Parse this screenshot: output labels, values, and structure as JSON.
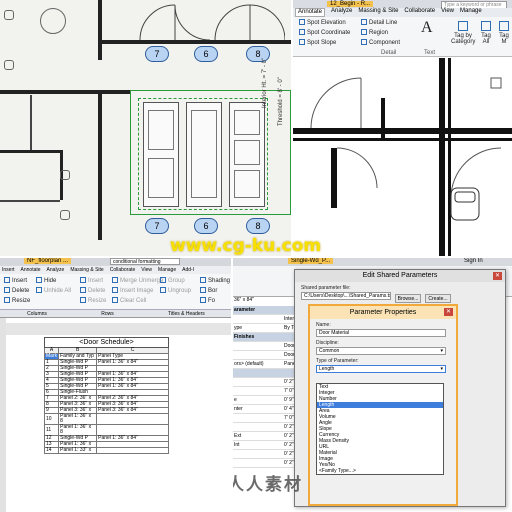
{
  "floorplan": {
    "door_tags": [
      "7",
      "6",
      "8"
    ],
    "elevation_tags": [
      "7",
      "6",
      "8"
    ],
    "dimension_text": "Interior Ht. = 7' - 0\"",
    "dimension_text_2": "Threshold = 8' - 0\""
  },
  "ribbon_view": {
    "title_tab": "12_Begin - R...",
    "search_placeholder": "Type a keyword or phrase",
    "tabs": [
      "Annotate",
      "Analyze",
      "Massing & Site",
      "Collaborate",
      "View",
      "Manage"
    ],
    "active_tab": "Annotate",
    "items": {
      "spot_elevation": "Spot Elevation",
      "spot_coordinate": "Spot Coordinate",
      "spot_slope": "Spot Slope",
      "detail_line": "Detail Line",
      "region": "Region",
      "component": "Component",
      "text": "A",
      "tag_by_category": "Tag by Category",
      "tag_all": "Tag All",
      "tag_multi": "Tag M",
      "detail_panel": "Detail",
      "text_panel": "Text"
    }
  },
  "schedule_view": {
    "window_title": "NF_floorplan ...",
    "search_value": "conditional formatting",
    "tabs": [
      "Insert",
      "Annotate",
      "Analyze",
      "Massing & Site",
      "Collaborate",
      "View",
      "Manage",
      "Add-I"
    ],
    "buttons": {
      "insert": "Insert",
      "hide": "Hide",
      "delete": "Delete",
      "unhide_all": "Unhide All",
      "resize": "Resize",
      "insert_row": "Insert",
      "delete_row": "Delete",
      "resize_row": "Resize",
      "merge_unmerge": "Merge Unmerge",
      "insert_image": "Insert Image",
      "clear_cell": "Clear Cell",
      "group": "Group",
      "ungroup": "Ungroup",
      "shading": "Shading",
      "borders": "Bor",
      "font": "Fo"
    },
    "panels": [
      "Columns",
      "Rows",
      "Titles & Headers"
    ],
    "schedule_title": "<Door Schedule>",
    "columns": [
      "A",
      "B",
      "C"
    ],
    "headers": [
      "Mark",
      "Family and Typ",
      "Panel Type"
    ],
    "rows": [
      [
        "1",
        "Single-Wd P",
        "Panel 1: 36\" x 84\""
      ],
      [
        "2",
        "Single-Wd P",
        ""
      ],
      [
        "3",
        "Single-Wd P",
        "Panel 1: 36\" x 84\""
      ],
      [
        "4",
        "Single-Wd P",
        "Panel 1: 36\" x 84\""
      ],
      [
        "5",
        "Single-Wd P",
        "Panel 1: 36\" x 84\""
      ],
      [
        "6",
        "Single-Flush",
        ""
      ],
      [
        "7",
        "Panel 2: 36\" x",
        "Panel 2: 36\" x 84\""
      ],
      [
        "8",
        "Panel 3: 36\" x",
        "Panel 3: 36\" x 84\""
      ],
      [
        "9",
        "Panel 3: 36\" x",
        "Panel 3: 36\" x 84\""
      ],
      [
        "10",
        "Panel 1: 36\" x 8",
        ""
      ],
      [
        "11",
        "Panel 1: 36\" x 8",
        ""
      ],
      [
        "12",
        "Single-Wd P",
        "Panel 1: 36\" x 84\""
      ],
      [
        "13",
        "Panel 1: 36\" x",
        ""
      ],
      [
        "14",
        "Panel 1: 33\" x",
        ""
      ]
    ]
  },
  "dialog_view": {
    "window_title": "Single-Wd_P...",
    "sign_in": "Sign In",
    "size_label": "36\" x 84\"",
    "property_rows": [
      {
        "label": "arameter",
        "value": "",
        "head": true
      },
      {
        "label": "",
        "value": "Interior",
        "head": false
      },
      {
        "label": "ype",
        "value": "By Text",
        "head": false
      },
      {
        "label": "Finishes",
        "value": "",
        "head": true
      },
      {
        "label": "",
        "value": "Door -",
        "head": false
      },
      {
        "label": "",
        "value": "Door -",
        "head": false
      },
      {
        "label": "ors> (default)",
        "value": "Panel -",
        "head": false
      },
      {
        "label": "",
        "value": "",
        "head": true
      },
      {
        "label": "",
        "value": "0' 2\"",
        "head": false
      },
      {
        "label": "",
        "value": "7' 0\"",
        "head": false
      },
      {
        "label": "e",
        "value": "0' 9\"",
        "head": false
      },
      {
        "label": "nter",
        "value": "0' 4\"",
        "head": false
      },
      {
        "label": "",
        "value": "7' 0\"",
        "head": false
      },
      {
        "label": "",
        "value": "0' 2\"",
        "head": false
      },
      {
        "label": "Ext",
        "value": "0' 2\"",
        "head": false
      },
      {
        "label": "Int",
        "value": "0' 2\"",
        "head": false
      },
      {
        "label": "",
        "value": "0' 2\"",
        "head": false
      },
      {
        "label": "",
        "value": "0' 2\"",
        "head": false
      }
    ],
    "outer_dialog_title": "Edit Shared Parameters",
    "outer_file_label": "Shared parameter file:",
    "outer_file_value": "C:\\Users\\Desktop\\...\\Shared_Params.txt",
    "outer_browse": "Browse...",
    "outer_create": "Create...",
    "inner_dialog_title": "Parameter Properties",
    "name_label": "Name:",
    "name_value": "Door Material",
    "discipline_label": "Discipline:",
    "discipline_value": "Common",
    "type_label": "Type of Parameter:",
    "type_value": "Length",
    "type_options": [
      "Text",
      "Integer",
      "Number",
      "Length",
      "Area",
      "Volume",
      "Angle",
      "Slope",
      "Currency",
      "Mass Density",
      "URL",
      "Material",
      "Image",
      "Yes/No",
      "<Family Type...>"
    ],
    "selected_option": "Length",
    "colors": {
      "highlight": "#3d7ddb",
      "dialog_border": "#f2a93b"
    }
  },
  "watermark": {
    "text_en": "www.cg-ku.com",
    "text_cn": "人人素材"
  }
}
